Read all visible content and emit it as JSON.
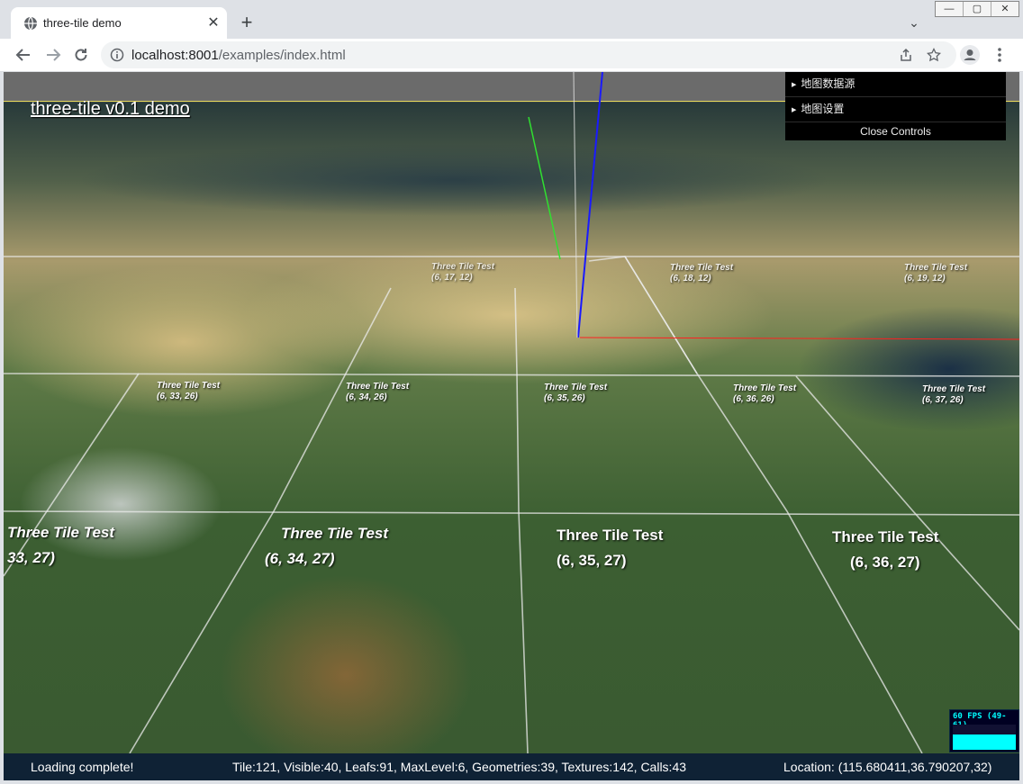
{
  "browser": {
    "tab_title": "three-tile demo",
    "tab_close": "✕",
    "new_tab": "+",
    "tab_search": "⌄",
    "window_controls": [
      "—",
      "▢",
      "✕"
    ],
    "url_host": "localhost:8001",
    "url_path": "/examples/index.html",
    "icons": {
      "back": "back-arrow-icon",
      "forward": "forward-arrow-icon",
      "reload": "reload-icon",
      "info": "info-icon",
      "share": "share-icon",
      "bookmark": "star-icon",
      "profile": "profile-icon",
      "menu": "kebab-menu-icon"
    }
  },
  "app": {
    "title": "three-tile v0.1 demo",
    "controls": {
      "folders": [
        "地图数据源",
        "地图设置"
      ],
      "close_label": "Close Controls"
    },
    "stats": {
      "fps_text": "60 FPS (49-61)",
      "fill_fraction": 0.6
    },
    "tiles": [
      {
        "name": "Three Tile Test",
        "coord": "(6, 17, 12)"
      },
      {
        "name": "Three Tile Test",
        "coord": "(6, 18, 12)"
      },
      {
        "name": "Three Tile Test",
        "coord": "(6, 19, 12)"
      },
      {
        "name": "Three Tile Test",
        "coord": "(6, 33, 26)"
      },
      {
        "name": "Three Tile Test",
        "coord": "(6, 34, 26)"
      },
      {
        "name": "Three Tile Test",
        "coord": "(6, 35, 26)"
      },
      {
        "name": "Three Tile Test",
        "coord": "(6, 36, 26)"
      },
      {
        "name": "Three Tile Test",
        "coord": "(6, 37, 26)"
      },
      {
        "name": "Three Tile Test",
        "coord": "33, 27)"
      },
      {
        "name": "Three Tile Test",
        "coord": "(6, 34, 27)"
      },
      {
        "name": "Three Tile Test",
        "coord": "(6, 35, 27)"
      },
      {
        "name": "Three Tile Test",
        "coord": "(6, 36, 27)"
      }
    ],
    "colors": {
      "statusbar": "#0f2235",
      "axis_x": "#ff2020",
      "axis_y": "#30e030",
      "axis_z": "#1a1aff"
    }
  },
  "status": {
    "left": "Loading complete!",
    "middle": "Tile:121, Visible:40, Leafs:91, MaxLevel:6, Geometries:39, Textures:142, Calls:43",
    "right": "Location: (115.680411,36.790207,32)"
  }
}
